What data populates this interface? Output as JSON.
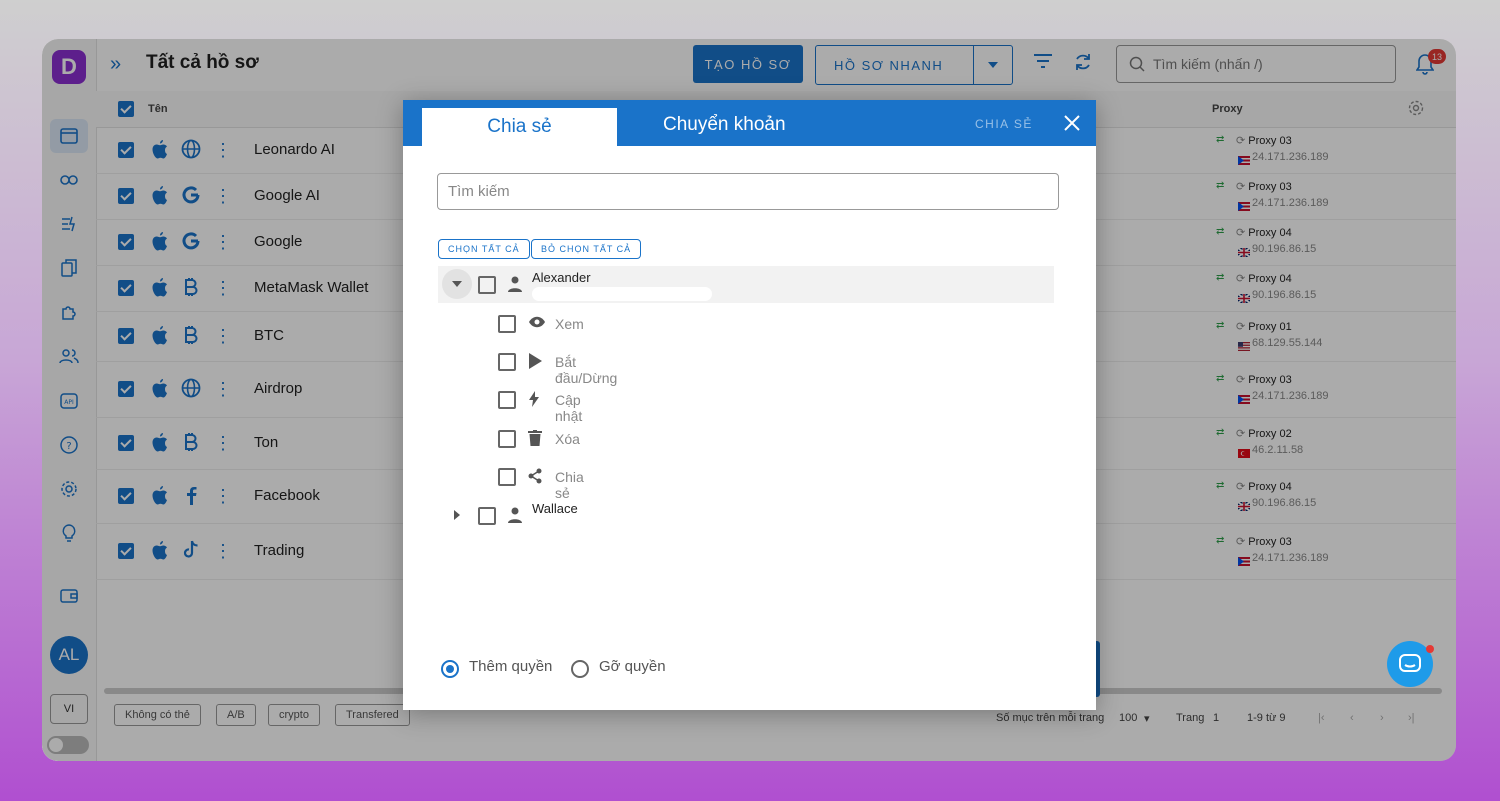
{
  "app": {
    "logo": "D",
    "title": "Tất cả hồ sơ",
    "create_btn": "TẠO HỒ SƠ",
    "quick_btn": "HỒ SƠ NHANH",
    "search_placeholder": "Tìm kiếm (nhấn /)",
    "notif_count": "13",
    "avatar": "AL",
    "lang": "VI"
  },
  "table": {
    "col_name": "Tên",
    "col_proxy": "Proxy",
    "rows": [
      {
        "name": "Leonardo AI",
        "site": "globe-icon",
        "proxy": "Proxy 03",
        "ip": "24.171.236.189",
        "flag": "pr"
      },
      {
        "name": "Google AI",
        "site": "google-icon",
        "proxy": "Proxy 03",
        "ip": "24.171.236.189",
        "flag": "pr"
      },
      {
        "name": "Google",
        "site": "google-icon",
        "proxy": "Proxy 04",
        "ip": "90.196.86.15",
        "flag": "uk"
      },
      {
        "name": "MetaMask Wallet",
        "site": "bitcoin-icon",
        "proxy": "Proxy 04",
        "ip": "90.196.86.15",
        "flag": "uk"
      },
      {
        "name": "BTC",
        "site": "bitcoin-icon",
        "proxy": "Proxy 01",
        "ip": "68.129.55.144",
        "flag": "us"
      },
      {
        "name": "Airdrop",
        "site": "globe-icon",
        "proxy": "Proxy 03",
        "ip": "24.171.236.189",
        "flag": "pr"
      },
      {
        "name": "Ton",
        "site": "bitcoin-icon",
        "proxy": "Proxy 02",
        "ip": "46.2.11.58",
        "flag": "tr"
      },
      {
        "name": "Facebook",
        "site": "facebook-icon",
        "proxy": "Proxy 04",
        "ip": "90.196.86.15",
        "flag": "uk"
      },
      {
        "name": "Trading",
        "site": "tiktok-icon",
        "proxy": "Proxy 03",
        "ip": "24.171.236.189",
        "flag": "pr"
      }
    ]
  },
  "footer": {
    "tags": [
      "Không có thẻ",
      "A/B",
      "crypto",
      "Transfered"
    ],
    "per_page_label": "Số mục trên mỗi trang",
    "per_page": "100",
    "page_label": "Trang",
    "page": "1",
    "range": "1-9 từ 9"
  },
  "modal": {
    "tab_share": "Chia sẻ",
    "tab_transfer": "Chuyển khoản",
    "action": "CHIA SẺ",
    "search_placeholder": "Tìm kiếm",
    "select_all": "CHỌN TẤT CẢ",
    "deselect_all": "BỎ CHỌN TẤT CẢ",
    "users": [
      {
        "name": "Alexander",
        "expanded": true
      },
      {
        "name": "Wallace",
        "expanded": false
      }
    ],
    "permissions": [
      {
        "label": "Xem",
        "icon": "eye-icon"
      },
      {
        "label": "Bắt đầu/Dừng",
        "icon": "play-icon"
      },
      {
        "label": "Cập nhật",
        "icon": "bolt-icon"
      },
      {
        "label": "Xóa",
        "icon": "trash-icon"
      },
      {
        "label": "Chia sẻ",
        "icon": "share-icon"
      }
    ],
    "radio_add": "Thêm quyền",
    "radio_remove": "Gỡ quyền",
    "selected_radio": "add"
  },
  "colors": {
    "accent": "#1a73c9",
    "brand": "#8b2fd1",
    "badge": "#e53935"
  }
}
